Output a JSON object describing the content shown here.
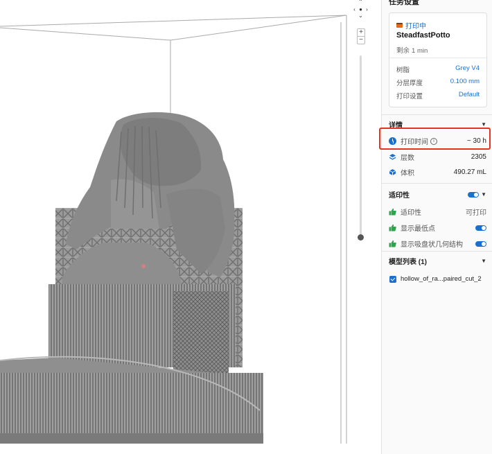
{
  "panel": {
    "title": "任务设置",
    "status": {
      "state": "打印中",
      "job_name": "SteadfastPotto",
      "remaining_label": "剩余",
      "remaining_value": "1 min",
      "rows": [
        {
          "label": "树脂",
          "value": "Grey V4"
        },
        {
          "label": "分层厚度",
          "value": "0.100 mm"
        },
        {
          "label": "打印设置",
          "value": "Default"
        }
      ]
    },
    "details": {
      "title": "详情",
      "print_time_label": "打印时间",
      "print_time_value": "~ 30 h",
      "layers_label": "层数",
      "layers_value": "2305",
      "volume_label": "体积",
      "volume_value": "490.27 mL"
    },
    "printability": {
      "title": "适印性",
      "status_label": "适印性",
      "status_value": "可打印",
      "show_min_points_label": "显示最低点",
      "show_cup_label": "显示吸盘状几何结构"
    },
    "models": {
      "title": "模型列表 (1)",
      "items": [
        "hollow_of_ra...paired_cut_2"
      ]
    }
  },
  "viewport": {
    "zoom_in": "+",
    "zoom_out": "−"
  },
  "colors": {
    "accent": "#1a6fd1",
    "highlight": "#e53322",
    "ok_green": "#2ea44f",
    "model_grey": "#8c8c8c"
  }
}
